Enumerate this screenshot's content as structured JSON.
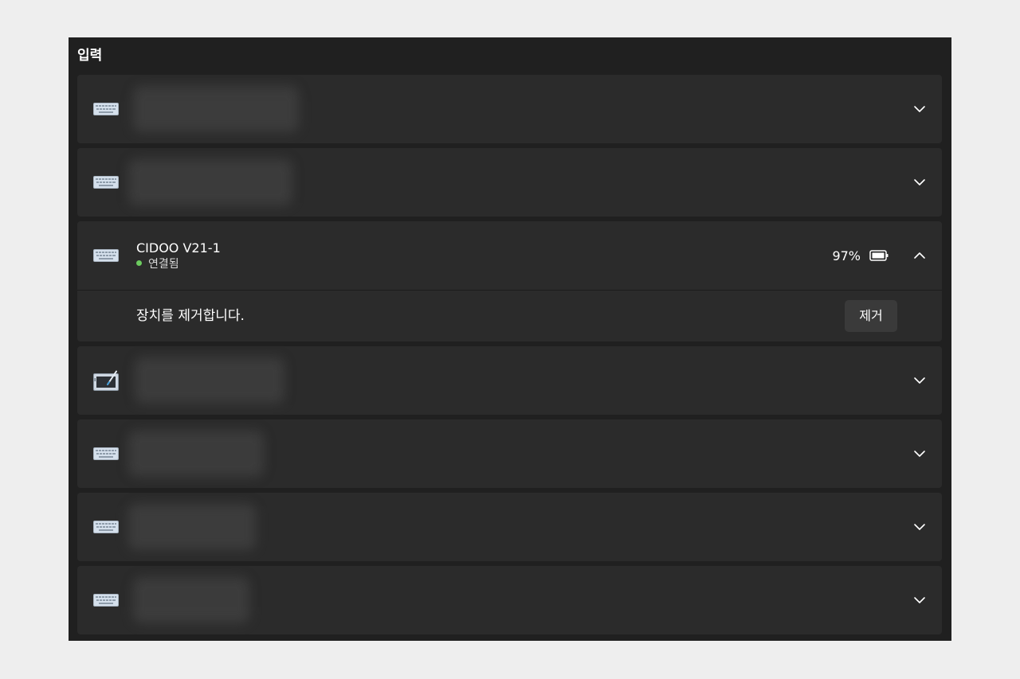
{
  "section": {
    "title": "입력"
  },
  "devices": [
    {
      "icon": "keyboard-icon",
      "name_visibility": "blurred",
      "expanded": false
    },
    {
      "icon": "keyboard-icon",
      "name_visibility": "blurred",
      "expanded": false
    },
    {
      "icon": "keyboard-icon",
      "name": "CIDOO V21-1",
      "status": "연결됨",
      "status_color": "#6ccb5f",
      "battery": "97%",
      "battery_icon": "battery-icon",
      "expanded": true,
      "expand": {
        "description": "장치를 제거합니다.",
        "button_label": "제거"
      }
    },
    {
      "icon": "pen-tablet-icon",
      "name_visibility": "blurred",
      "expanded": false
    },
    {
      "icon": "keyboard-icon",
      "name_visibility": "blurred",
      "expanded": false
    },
    {
      "icon": "keyboard-icon",
      "name_visibility": "blurred",
      "expanded": false
    },
    {
      "icon": "keyboard-icon",
      "name_visibility": "blurred",
      "expanded": false
    }
  ],
  "colors": {
    "page_background": "#eeeeee",
    "panel_background": "#202020",
    "card_background": "#2b2b2b",
    "button_background": "#3a3a3a",
    "text": "#ffffff"
  }
}
